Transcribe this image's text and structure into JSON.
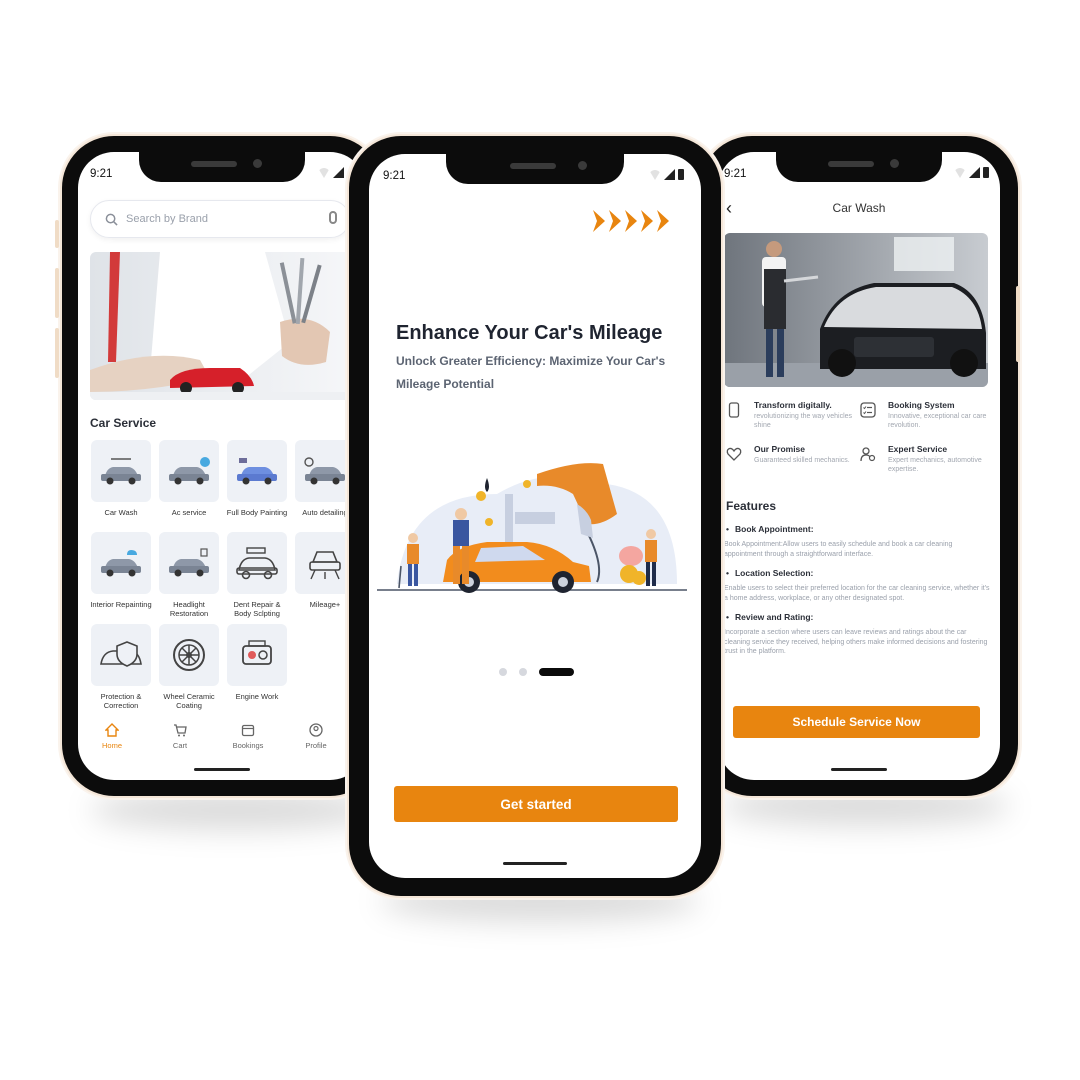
{
  "phone_left": {
    "time": "9:21",
    "search_placeholder": "Search by Brand",
    "section_title": "Car Service",
    "services": [
      {
        "label": "Car Wash",
        "icon": "car-wash-icon"
      },
      {
        "label": "Ac service",
        "icon": "ac-service-icon"
      },
      {
        "label": "Full Body Painting",
        "icon": "body-painting-icon"
      },
      {
        "label": "Auto detailing",
        "icon": "auto-detailing-icon"
      },
      {
        "label": "Interior Repainting",
        "icon": "interior-icon"
      },
      {
        "label": "Headlight Restoration",
        "icon": "headlight-icon"
      },
      {
        "label": "Dent Repair & Body Sclpting",
        "icon": "dent-repair-icon"
      },
      {
        "label": "Mileage+",
        "icon": "mileage-icon"
      },
      {
        "label": "Protection & Correction",
        "icon": "protection-icon"
      },
      {
        "label": "Wheel Ceramic Coating",
        "icon": "wheel-icon"
      },
      {
        "label": "Engine Work",
        "icon": "engine-icon"
      }
    ],
    "tabs": [
      {
        "label": "Home",
        "icon": "home-icon",
        "active": true
      },
      {
        "label": "Cart",
        "icon": "cart-icon",
        "active": false
      },
      {
        "label": "Bookings",
        "icon": "bookings-icon",
        "active": false
      },
      {
        "label": "Profile",
        "icon": "profile-icon",
        "active": false
      }
    ]
  },
  "phone_middle": {
    "time": "9:21",
    "headline": "Enhance Your Car's Mileage",
    "subtitle": "Unlock Greater Efficiency: Maximize Your Car's Mileage Potential",
    "pagination": {
      "total": 3,
      "active_index": 2
    },
    "cta_label": "Get started"
  },
  "phone_right": {
    "time": "9:21",
    "title": "Car Wash",
    "highlights": [
      {
        "title": "Transform digitally.",
        "desc": "revolutionizing the way vehicles shine",
        "icon": "phone-icon"
      },
      {
        "title": "Booking System",
        "desc": "Innovative, exceptional car care revolution.",
        "icon": "checklist-icon"
      },
      {
        "title": "Our Promise",
        "desc": "Guaranteed skilled mechanics.",
        "icon": "heart-icon"
      },
      {
        "title": "Expert Service",
        "desc": "Expert mechanics, automotive expertise.",
        "icon": "expert-icon"
      }
    ],
    "features_title": "Features",
    "features": [
      {
        "title": "Book Appointment:",
        "desc": "Book Appointment:Allow users to easily schedule and book a car cleaning appointment through a straightforward interface."
      },
      {
        "title": "Location Selection:",
        "desc": "Enable users to select their preferred location for the car cleaning service, whether it's a home address, workplace, or any other designated spot."
      },
      {
        "title": "Review and Rating:",
        "desc": "Incorporate a section where users can leave reviews and ratings about the car cleaning service they received, helping others make informed decisions and fostering trust in the platform."
      }
    ],
    "cta_label": "Schedule Service Now"
  },
  "colors": {
    "accent": "#e8850f",
    "ink": "#1f2430",
    "muted": "#9aa0ab",
    "tile": "#eef1f6"
  }
}
